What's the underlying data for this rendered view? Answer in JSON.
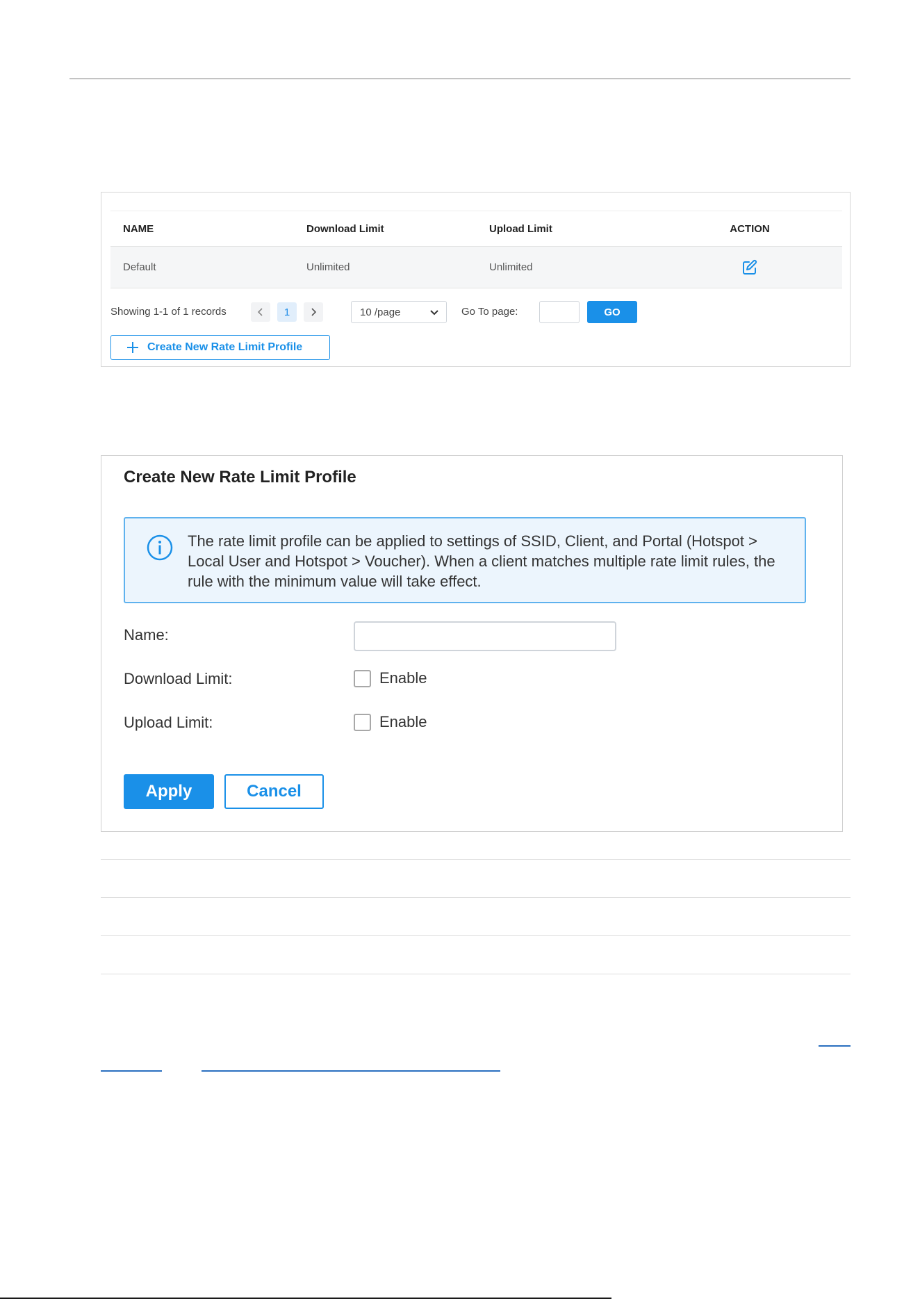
{
  "table": {
    "columns": [
      "NAME",
      "Download Limit",
      "Upload Limit",
      "ACTION"
    ],
    "rows": [
      {
        "name": "Default",
        "download": "Unlimited",
        "upload": "Unlimited",
        "action_icon": "edit-icon"
      }
    ]
  },
  "pagination": {
    "records": "Showing 1-1 of 1 records",
    "prev": "‹",
    "current_page": "1",
    "next": "›",
    "per_page": "10 /page",
    "goto_label": "Go To page:",
    "go_label": "GO"
  },
  "create_button": {
    "label": "Create New Rate Limit Profile",
    "icon": "plus-icon"
  },
  "form": {
    "title": "Create New Rate Limit Profile",
    "info_icon": "info-icon",
    "info_text": "The rate limit profile can be applied to settings of SSID, Client, and Portal (Hotspot > Local User and Hotspot > Voucher). When a client matches multiple rate limit rules, the rule with the minimum value will take effect.",
    "name_label": "Name:",
    "name_value": "",
    "download_label": "Download Limit:",
    "upload_label": "Upload Limit:",
    "enable_label": "Enable",
    "download_enabled": false,
    "upload_enabled": false,
    "apply_label": "Apply",
    "cancel_label": "Cancel"
  },
  "colors": {
    "accent": "#1a90e8",
    "info_bg": "#ecf5fd",
    "info_border": "#5fb2ee",
    "row_bg": "#f5f6f7"
  }
}
